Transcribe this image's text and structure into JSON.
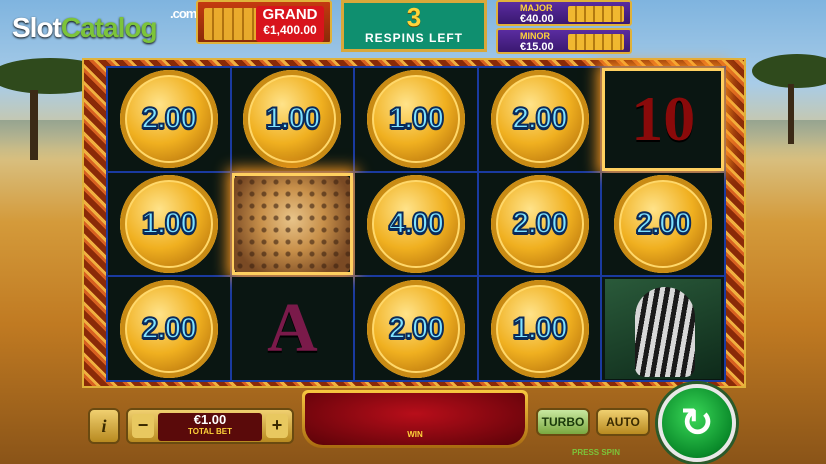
{
  "brand": {
    "name_part1": "Slot",
    "name_part2": "Catalog",
    "suffix": ".com"
  },
  "jackpots": {
    "grand": {
      "label": "GRAND",
      "value": "€1,400.00"
    },
    "major": {
      "label": "MAJOR",
      "value": "€40.00"
    },
    "minor": {
      "label": "MINOR",
      "value": "€15.00"
    }
  },
  "respins": {
    "count": "3",
    "label": "RESPINS LEFT"
  },
  "reels": {
    "rows": [
      [
        {
          "type": "coin",
          "value": "2.00"
        },
        {
          "type": "coin",
          "value": "1.00"
        },
        {
          "type": "coin",
          "value": "1.00"
        },
        {
          "type": "coin",
          "value": "2.00"
        },
        {
          "type": "symbol",
          "value": "10"
        }
      ],
      [
        {
          "type": "coin",
          "value": "1.00"
        },
        {
          "type": "symbol",
          "value": "cheetah"
        },
        {
          "type": "coin",
          "value": "4.00"
        },
        {
          "type": "coin",
          "value": "2.00"
        },
        {
          "type": "coin",
          "value": "2.00"
        }
      ],
      [
        {
          "type": "coin",
          "value": "2.00"
        },
        {
          "type": "symbol",
          "value": "A"
        },
        {
          "type": "coin",
          "value": "2.00"
        },
        {
          "type": "coin",
          "value": "1.00"
        },
        {
          "type": "symbol",
          "value": "zebra"
        }
      ]
    ]
  },
  "controls": {
    "info_label": "i",
    "minus": "−",
    "plus": "+",
    "bet_amount": "€1.00",
    "bet_label": "TOTAL BET",
    "win_label": "WIN",
    "turbo": "TURBO",
    "auto": "AUTO",
    "press_spin": "PRESS SPIN",
    "spin_icon": "↻"
  }
}
